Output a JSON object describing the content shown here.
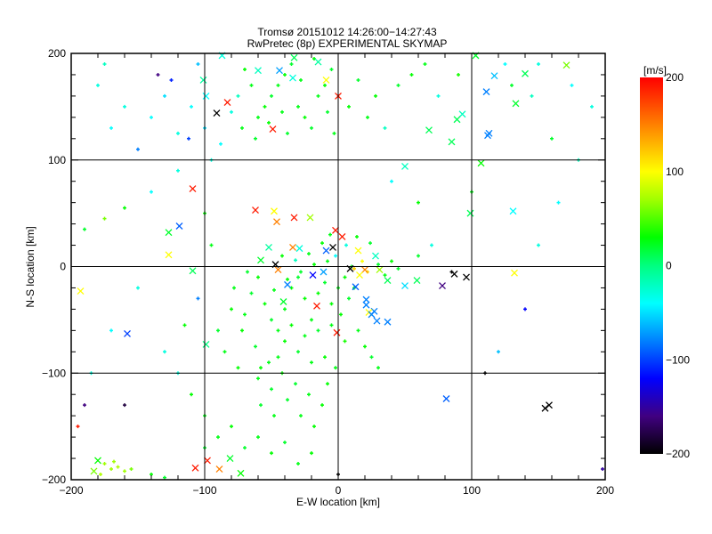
{
  "chart_data": {
    "type": "scatter",
    "title": "Tromsø 20151012 14:26:00−14:27:43",
    "subtitle": "RwPretec (8p) EXPERIMENTAL SKYMAP",
    "xlabel": "E-W location [km]",
    "ylabel": "N-S location [km]",
    "xlim": [
      -200,
      200
    ],
    "ylim": [
      -200,
      200
    ],
    "xticks": [
      -200,
      -100,
      0,
      100,
      200
    ],
    "yticks": [
      -200,
      -100,
      0,
      100,
      200
    ],
    "xtick_labels": [
      "−200",
      "−100",
      "0",
      "100",
      "200"
    ],
    "ytick_labels": [
      "−200",
      "−100",
      "0",
      "100",
      "200"
    ],
    "minor_tick_step": 20,
    "grid": true,
    "colorbar": {
      "label": "[m/s]",
      "range": [
        -200,
        200
      ],
      "ticks": [
        200,
        100,
        0,
        -100,
        -200
      ],
      "tick_labels": [
        "200",
        "100",
        "0",
        "−100",
        "−200"
      ],
      "colormap": [
        [
          -200,
          "#000000"
        ],
        [
          -160,
          "#400080"
        ],
        [
          -120,
          "#0000ff"
        ],
        [
          -80,
          "#0080ff"
        ],
        [
          -40,
          "#00ffff"
        ],
        [
          0,
          "#00ff80"
        ],
        [
          30,
          "#00ff00"
        ],
        [
          70,
          "#a0ff00"
        ],
        [
          100,
          "#ffff00"
        ],
        [
          150,
          "#ff8000"
        ],
        [
          200,
          "#ff0000"
        ]
      ]
    },
    "series_note_units": "points are [x_km, y_km, velocity_m_s]",
    "crosses": [
      [
        -83,
        154,
        190
      ],
      [
        -91,
        144,
        -200
      ],
      [
        -49,
        129,
        190
      ],
      [
        0,
        160,
        190
      ],
      [
        -109,
        73,
        190
      ],
      [
        -62,
        53,
        190
      ],
      [
        -48,
        52,
        100
      ],
      [
        -33,
        46,
        190
      ],
      [
        -21,
        46,
        70
      ],
      [
        -46,
        42,
        150
      ],
      [
        -2,
        34,
        190
      ],
      [
        3,
        28,
        190
      ],
      [
        -4,
        18,
        -200
      ],
      [
        -9,
        15,
        -90
      ],
      [
        15,
        15,
        100
      ],
      [
        -52,
        18,
        -10
      ],
      [
        -34,
        18,
        150
      ],
      [
        -29,
        17,
        -30
      ],
      [
        -58,
        6,
        20
      ],
      [
        -47,
        2,
        -200
      ],
      [
        28,
        10,
        -20
      ],
      [
        9,
        -2,
        -200
      ],
      [
        20,
        -3,
        150
      ],
      [
        31,
        -3,
        70
      ],
      [
        16,
        -8,
        100
      ],
      [
        -45,
        -3,
        150
      ],
      [
        -19,
        -8,
        -120
      ],
      [
        -11,
        -5,
        -70
      ],
      [
        -38,
        -17,
        -80
      ],
      [
        37,
        -13,
        10
      ],
      [
        50,
        -18,
        -50
      ],
      [
        59,
        -13,
        10
      ],
      [
        13,
        -19,
        -90
      ],
      [
        -41,
        -33,
        20
      ],
      [
        -16,
        -37,
        190
      ],
      [
        21,
        -31,
        -80
      ],
      [
        21,
        -36,
        -80
      ],
      [
        27,
        -42,
        -80
      ],
      [
        23,
        -43,
        100
      ],
      [
        25,
        -45,
        -80
      ],
      [
        29,
        -51,
        -80
      ],
      [
        37,
        -52,
        -80
      ],
      [
        -1,
        -62,
        190
      ],
      [
        87,
        -7,
        -200
      ],
      [
        96,
        -10,
        -200
      ],
      [
        78,
        -18,
        -160
      ],
      [
        132,
        -6,
        100
      ],
      [
        81,
        -124,
        -90
      ],
      [
        155,
        -133,
        -200
      ],
      [
        158,
        -130,
        -200
      ],
      [
        -109,
        -4,
        10
      ],
      [
        -127,
        32,
        20
      ],
      [
        -119,
        38,
        -90
      ],
      [
        -127,
        11,
        100
      ],
      [
        -158,
        -63,
        -100
      ],
      [
        -193,
        -23,
        100
      ],
      [
        -99,
        -73,
        0
      ],
      [
        131,
        52,
        -40
      ],
      [
        99,
        50,
        10
      ],
      [
        107,
        97,
        30
      ],
      [
        133,
        153,
        20
      ],
      [
        113,
        125,
        -80
      ],
      [
        112,
        123,
        -80
      ],
      [
        111,
        164,
        -80
      ],
      [
        117,
        179,
        -60
      ],
      [
        140,
        181,
        10
      ],
      [
        85,
        117,
        10
      ],
      [
        93,
        143,
        -20
      ],
      [
        89,
        138,
        10
      ],
      [
        68,
        128,
        10
      ],
      [
        50,
        94,
        -20
      ],
      [
        171,
        189,
        60
      ],
      [
        103,
        198,
        20
      ],
      [
        -87,
        198,
        -30
      ],
      [
        -60,
        184,
        -20
      ],
      [
        -44,
        184,
        -70
      ],
      [
        -34,
        177,
        -30
      ],
      [
        -9,
        175,
        100
      ],
      [
        -15,
        192,
        -10
      ],
      [
        -99,
        160,
        -40
      ],
      [
        -101,
        175,
        -10
      ],
      [
        -33,
        196,
        10
      ],
      [
        -107,
        -189,
        190
      ],
      [
        -89,
        -190,
        150
      ],
      [
        -98,
        -182,
        190
      ],
      [
        -81,
        -180,
        20
      ],
      [
        -73,
        -194,
        30
      ],
      [
        -180,
        -182,
        30
      ],
      [
        -183,
        -192,
        60
      ]
    ],
    "points": [
      [
        -40,
        -40,
        25
      ],
      [
        -35,
        -20,
        30
      ],
      [
        -30,
        -10,
        20
      ],
      [
        -25,
        -30,
        30
      ],
      [
        -20,
        -50,
        25
      ],
      [
        -15,
        -25,
        30
      ],
      [
        -10,
        -15,
        20
      ],
      [
        -5,
        -35,
        30
      ],
      [
        0,
        -20,
        25
      ],
      [
        5,
        -10,
        30
      ],
      [
        10,
        0,
        20
      ],
      [
        -8,
        5,
        25
      ],
      [
        -18,
        2,
        30
      ],
      [
        -28,
        -5,
        20
      ],
      [
        -38,
        -12,
        30
      ],
      [
        -48,
        -22,
        25
      ],
      [
        -55,
        -35,
        30
      ],
      [
        -50,
        -50,
        20
      ],
      [
        -45,
        -60,
        25
      ],
      [
        -40,
        -70,
        30
      ],
      [
        -30,
        -80,
        20
      ],
      [
        -20,
        -90,
        25
      ],
      [
        -10,
        -85,
        30
      ],
      [
        -25,
        -65,
        25
      ],
      [
        -35,
        -55,
        30
      ],
      [
        -15,
        -60,
        20
      ],
      [
        -5,
        -55,
        25
      ],
      [
        2,
        -45,
        30
      ],
      [
        8,
        -30,
        20
      ],
      [
        12,
        -20,
        25
      ],
      [
        -60,
        -10,
        30
      ],
      [
        -65,
        -25,
        20
      ],
      [
        -70,
        -45,
        25
      ],
      [
        -72,
        -60,
        30
      ],
      [
        -62,
        -75,
        20
      ],
      [
        -52,
        -90,
        25
      ],
      [
        -42,
        -100,
        30
      ],
      [
        -32,
        -110,
        20
      ],
      [
        -22,
        -120,
        25
      ],
      [
        -12,
        -130,
        30
      ],
      [
        -50,
        -115,
        20
      ],
      [
        -60,
        -105,
        25
      ],
      [
        -75,
        -95,
        30
      ],
      [
        -85,
        -80,
        25
      ],
      [
        -90,
        -60,
        20
      ],
      [
        -80,
        -40,
        30
      ],
      [
        -78,
        -20,
        25
      ],
      [
        -68,
        -5,
        20
      ],
      [
        -58,
        -95,
        30
      ],
      [
        -45,
        -85,
        25
      ],
      [
        -38,
        -125,
        20
      ],
      [
        -28,
        -140,
        25
      ],
      [
        -18,
        -150,
        30
      ],
      [
        -48,
        -140,
        25
      ],
      [
        -58,
        -130,
        20
      ],
      [
        -8,
        -110,
        30
      ],
      [
        15,
        -60,
        25
      ],
      [
        20,
        -75,
        30
      ],
      [
        25,
        -85,
        20
      ],
      [
        30,
        -95,
        25
      ],
      [
        5,
        -70,
        35
      ],
      [
        -2,
        -95,
        25
      ],
      [
        18,
        5,
        100
      ],
      [
        22,
        -5,
        110
      ],
      [
        12,
        -2,
        120
      ],
      [
        30,
        2,
        20
      ],
      [
        35,
        -8,
        25
      ],
      [
        40,
        5,
        30
      ],
      [
        45,
        -2,
        20
      ],
      [
        -2,
        10,
        -40
      ],
      [
        6,
        20,
        -30
      ],
      [
        -12,
        22,
        30
      ],
      [
        -22,
        12,
        25
      ],
      [
        -32,
        6,
        -20
      ],
      [
        -42,
        10,
        30
      ],
      [
        -6,
        30,
        25
      ],
      [
        14,
        28,
        30
      ],
      [
        24,
        22,
        20
      ],
      [
        -60,
        140,
        25
      ],
      [
        -55,
        150,
        30
      ],
      [
        -50,
        160,
        20
      ],
      [
        -45,
        170,
        25
      ],
      [
        -40,
        180,
        30
      ],
      [
        -35,
        190,
        20
      ],
      [
        -30,
        150,
        25
      ],
      [
        -25,
        140,
        30
      ],
      [
        -20,
        130,
        20
      ],
      [
        -15,
        160,
        25
      ],
      [
        -10,
        170,
        30
      ],
      [
        -5,
        185,
        20
      ],
      [
        -65,
        170,
        25
      ],
      [
        -70,
        185,
        30
      ],
      [
        -75,
        160,
        -20
      ],
      [
        -80,
        145,
        -30
      ],
      [
        -72,
        130,
        25
      ],
      [
        -62,
        120,
        20
      ],
      [
        -52,
        135,
        30
      ],
      [
        -42,
        145,
        25
      ],
      [
        -38,
        125,
        20
      ],
      [
        -28,
        175,
        25
      ],
      [
        -18,
        195,
        30
      ],
      [
        -8,
        145,
        20
      ],
      [
        -3,
        125,
        25
      ],
      [
        8,
        150,
        30
      ],
      [
        15,
        175,
        20
      ],
      [
        22,
        140,
        25
      ],
      [
        28,
        160,
        30
      ],
      [
        35,
        130,
        -20
      ],
      [
        -88,
        115,
        -40
      ],
      [
        -95,
        100,
        -30
      ],
      [
        -100,
        130,
        -50
      ],
      [
        -110,
        150,
        -40
      ],
      [
        -120,
        125,
        -30
      ],
      [
        -130,
        160,
        -50
      ],
      [
        -140,
        140,
        -40
      ],
      [
        -150,
        110,
        -80
      ],
      [
        -160,
        150,
        -30
      ],
      [
        -170,
        130,
        -40
      ],
      [
        -125,
        175,
        -110
      ],
      [
        -180,
        170,
        -30
      ],
      [
        -112,
        120,
        -100
      ],
      [
        -135,
        180,
        -160
      ],
      [
        -175,
        190,
        -20
      ],
      [
        -105,
        190,
        -60
      ],
      [
        -120,
        90,
        -30
      ],
      [
        -140,
        70,
        -40
      ],
      [
        -160,
        55,
        30
      ],
      [
        -175,
        45,
        60
      ],
      [
        -190,
        35,
        20
      ],
      [
        -150,
        -20,
        -30
      ],
      [
        -170,
        -60,
        -40
      ],
      [
        -185,
        -100,
        -30
      ],
      [
        -160,
        -130,
        -180
      ],
      [
        -195,
        -150,
        190
      ],
      [
        -190,
        -130,
        -160
      ],
      [
        -175,
        -185,
        70
      ],
      [
        -170,
        -190,
        70
      ],
      [
        -165,
        -188,
        75
      ],
      [
        -160,
        -192,
        70
      ],
      [
        -178,
        -195,
        75
      ],
      [
        -168,
        -183,
        70
      ],
      [
        -155,
        -190,
        60
      ],
      [
        -140,
        -195,
        30
      ],
      [
        -130,
        -198,
        20
      ],
      [
        -100,
        -170,
        20
      ],
      [
        -90,
        -160,
        25
      ],
      [
        -80,
        -150,
        30
      ],
      [
        -70,
        -170,
        20
      ],
      [
        -60,
        -160,
        25
      ],
      [
        -50,
        -175,
        30
      ],
      [
        -40,
        -165,
        20
      ],
      [
        -30,
        -185,
        25
      ],
      [
        -20,
        -175,
        30
      ],
      [
        0,
        -195,
        -200
      ],
      [
        -110,
        -120,
        30
      ],
      [
        -100,
        -140,
        25
      ],
      [
        -120,
        -100,
        -30
      ],
      [
        60,
        10,
        20
      ],
      [
        70,
        20,
        -30
      ],
      [
        85,
        -5,
        -200
      ],
      [
        110,
        -100,
        -200
      ],
      [
        120,
        -80,
        -60
      ],
      [
        140,
        -40,
        -120
      ],
      [
        150,
        20,
        -30
      ],
      [
        165,
        60,
        -40
      ],
      [
        180,
        100,
        -20
      ],
      [
        190,
        150,
        -30
      ],
      [
        160,
        120,
        20
      ],
      [
        175,
        170,
        -40
      ],
      [
        150,
        190,
        -30
      ],
      [
        125,
        190,
        -40
      ],
      [
        130,
        170,
        20
      ],
      [
        145,
        160,
        -20
      ],
      [
        65,
        190,
        25
      ],
      [
        55,
        180,
        30
      ],
      [
        75,
        160,
        -30
      ],
      [
        45,
        170,
        20
      ],
      [
        90,
        180,
        35
      ],
      [
        100,
        70,
        25
      ],
      [
        60,
        60,
        30
      ],
      [
        40,
        80,
        -40
      ],
      [
        -100,
        50,
        30
      ],
      [
        -95,
        20,
        25
      ],
      [
        -105,
        -30,
        -80
      ],
      [
        -115,
        -55,
        30
      ],
      [
        -130,
        -80,
        -30
      ],
      [
        198,
        -190,
        -150
      ]
    ]
  }
}
